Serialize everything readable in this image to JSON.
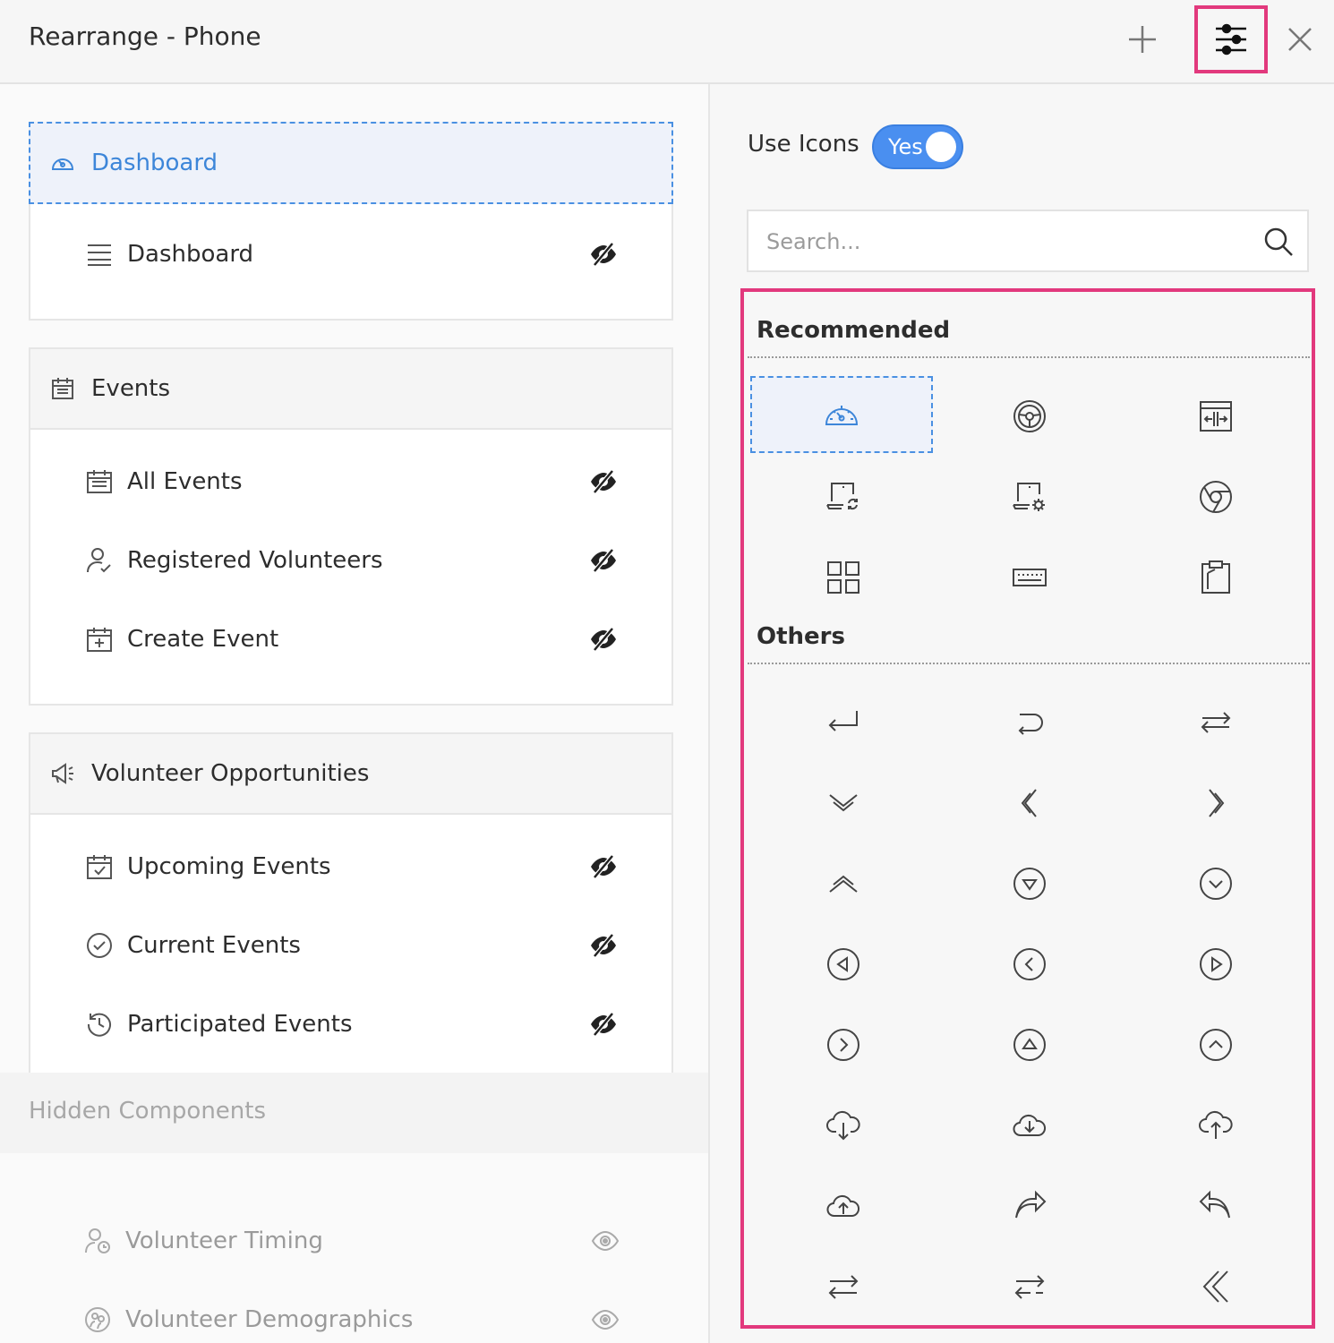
{
  "header": {
    "title": "Rearrange - Phone"
  },
  "left": {
    "groups": [
      {
        "title": "Dashboard",
        "items": [
          {
            "label": "Dashboard"
          }
        ]
      },
      {
        "title": "Events",
        "items": [
          {
            "label": "All Events"
          },
          {
            "label": "Registered Volunteers"
          },
          {
            "label": "Create Event"
          }
        ]
      },
      {
        "title": "Volunteer Opportunities",
        "items": [
          {
            "label": "Upcoming Events"
          },
          {
            "label": "Current Events"
          },
          {
            "label": "Participated Events"
          }
        ]
      }
    ],
    "hidden_title": "Hidden Components",
    "hidden_items": [
      {
        "label": "Volunteer Timing"
      },
      {
        "label": "Volunteer Demographics"
      }
    ]
  },
  "right": {
    "use_icons_label": "Use Icons",
    "toggle_label": "Yes",
    "search_placeholder": "Search...",
    "recommended_title": "Recommended",
    "others_title": "Others"
  },
  "colors": {
    "accent": "#4a90e2",
    "highlight": "#e2397d"
  }
}
